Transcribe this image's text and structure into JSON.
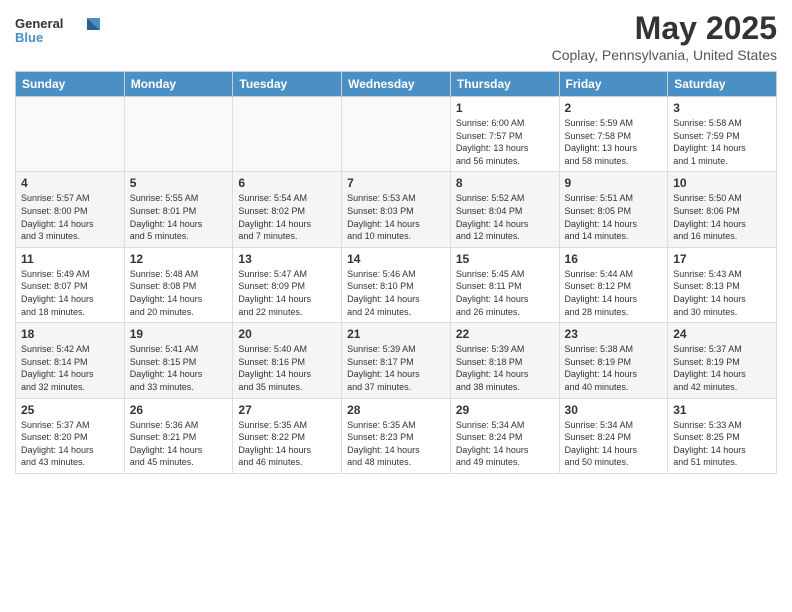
{
  "header": {
    "logo_general": "General",
    "logo_blue": "Blue",
    "title": "May 2025",
    "subtitle": "Coplay, Pennsylvania, United States"
  },
  "weekdays": [
    "Sunday",
    "Monday",
    "Tuesday",
    "Wednesday",
    "Thursday",
    "Friday",
    "Saturday"
  ],
  "weeks": [
    [
      {
        "day": "",
        "info": ""
      },
      {
        "day": "",
        "info": ""
      },
      {
        "day": "",
        "info": ""
      },
      {
        "day": "",
        "info": ""
      },
      {
        "day": "1",
        "info": "Sunrise: 6:00 AM\nSunset: 7:57 PM\nDaylight: 13 hours\nand 56 minutes."
      },
      {
        "day": "2",
        "info": "Sunrise: 5:59 AM\nSunset: 7:58 PM\nDaylight: 13 hours\nand 58 minutes."
      },
      {
        "day": "3",
        "info": "Sunrise: 5:58 AM\nSunset: 7:59 PM\nDaylight: 14 hours\nand 1 minute."
      }
    ],
    [
      {
        "day": "4",
        "info": "Sunrise: 5:57 AM\nSunset: 8:00 PM\nDaylight: 14 hours\nand 3 minutes."
      },
      {
        "day": "5",
        "info": "Sunrise: 5:55 AM\nSunset: 8:01 PM\nDaylight: 14 hours\nand 5 minutes."
      },
      {
        "day": "6",
        "info": "Sunrise: 5:54 AM\nSunset: 8:02 PM\nDaylight: 14 hours\nand 7 minutes."
      },
      {
        "day": "7",
        "info": "Sunrise: 5:53 AM\nSunset: 8:03 PM\nDaylight: 14 hours\nand 10 minutes."
      },
      {
        "day": "8",
        "info": "Sunrise: 5:52 AM\nSunset: 8:04 PM\nDaylight: 14 hours\nand 12 minutes."
      },
      {
        "day": "9",
        "info": "Sunrise: 5:51 AM\nSunset: 8:05 PM\nDaylight: 14 hours\nand 14 minutes."
      },
      {
        "day": "10",
        "info": "Sunrise: 5:50 AM\nSunset: 8:06 PM\nDaylight: 14 hours\nand 16 minutes."
      }
    ],
    [
      {
        "day": "11",
        "info": "Sunrise: 5:49 AM\nSunset: 8:07 PM\nDaylight: 14 hours\nand 18 minutes."
      },
      {
        "day": "12",
        "info": "Sunrise: 5:48 AM\nSunset: 8:08 PM\nDaylight: 14 hours\nand 20 minutes."
      },
      {
        "day": "13",
        "info": "Sunrise: 5:47 AM\nSunset: 8:09 PM\nDaylight: 14 hours\nand 22 minutes."
      },
      {
        "day": "14",
        "info": "Sunrise: 5:46 AM\nSunset: 8:10 PM\nDaylight: 14 hours\nand 24 minutes."
      },
      {
        "day": "15",
        "info": "Sunrise: 5:45 AM\nSunset: 8:11 PM\nDaylight: 14 hours\nand 26 minutes."
      },
      {
        "day": "16",
        "info": "Sunrise: 5:44 AM\nSunset: 8:12 PM\nDaylight: 14 hours\nand 28 minutes."
      },
      {
        "day": "17",
        "info": "Sunrise: 5:43 AM\nSunset: 8:13 PM\nDaylight: 14 hours\nand 30 minutes."
      }
    ],
    [
      {
        "day": "18",
        "info": "Sunrise: 5:42 AM\nSunset: 8:14 PM\nDaylight: 14 hours\nand 32 minutes."
      },
      {
        "day": "19",
        "info": "Sunrise: 5:41 AM\nSunset: 8:15 PM\nDaylight: 14 hours\nand 33 minutes."
      },
      {
        "day": "20",
        "info": "Sunrise: 5:40 AM\nSunset: 8:16 PM\nDaylight: 14 hours\nand 35 minutes."
      },
      {
        "day": "21",
        "info": "Sunrise: 5:39 AM\nSunset: 8:17 PM\nDaylight: 14 hours\nand 37 minutes."
      },
      {
        "day": "22",
        "info": "Sunrise: 5:39 AM\nSunset: 8:18 PM\nDaylight: 14 hours\nand 38 minutes."
      },
      {
        "day": "23",
        "info": "Sunrise: 5:38 AM\nSunset: 8:19 PM\nDaylight: 14 hours\nand 40 minutes."
      },
      {
        "day": "24",
        "info": "Sunrise: 5:37 AM\nSunset: 8:19 PM\nDaylight: 14 hours\nand 42 minutes."
      }
    ],
    [
      {
        "day": "25",
        "info": "Sunrise: 5:37 AM\nSunset: 8:20 PM\nDaylight: 14 hours\nand 43 minutes."
      },
      {
        "day": "26",
        "info": "Sunrise: 5:36 AM\nSunset: 8:21 PM\nDaylight: 14 hours\nand 45 minutes."
      },
      {
        "day": "27",
        "info": "Sunrise: 5:35 AM\nSunset: 8:22 PM\nDaylight: 14 hours\nand 46 minutes."
      },
      {
        "day": "28",
        "info": "Sunrise: 5:35 AM\nSunset: 8:23 PM\nDaylight: 14 hours\nand 48 minutes."
      },
      {
        "day": "29",
        "info": "Sunrise: 5:34 AM\nSunset: 8:24 PM\nDaylight: 14 hours\nand 49 minutes."
      },
      {
        "day": "30",
        "info": "Sunrise: 5:34 AM\nSunset: 8:24 PM\nDaylight: 14 hours\nand 50 minutes."
      },
      {
        "day": "31",
        "info": "Sunrise: 5:33 AM\nSunset: 8:25 PM\nDaylight: 14 hours\nand 51 minutes."
      }
    ]
  ]
}
